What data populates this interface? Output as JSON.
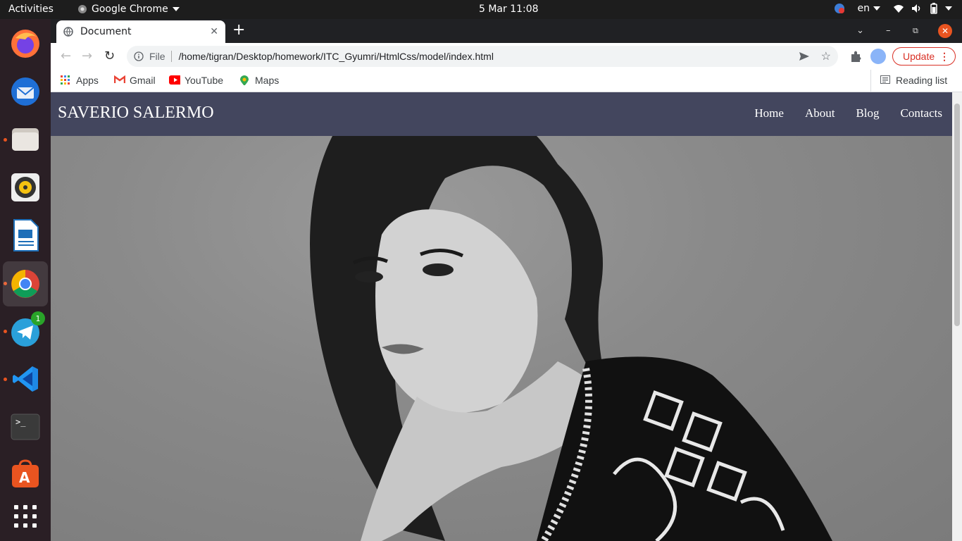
{
  "topbar": {
    "activities": "Activities",
    "app_name": "Google Chrome",
    "clock": "5 Mar  11:08",
    "language": "en"
  },
  "dock": {
    "items": [
      {
        "name": "firefox-icon"
      },
      {
        "name": "thunderbird-icon"
      },
      {
        "name": "files-icon"
      },
      {
        "name": "rhythmbox-icon"
      },
      {
        "name": "libreoffice-writer-icon"
      },
      {
        "name": "chrome-icon"
      },
      {
        "name": "telegram-icon",
        "badge": "1"
      },
      {
        "name": "vscode-icon"
      },
      {
        "name": "terminal-icon"
      },
      {
        "name": "software-center-icon"
      },
      {
        "name": "show-apps-icon"
      }
    ]
  },
  "browser": {
    "tab_title": "Document",
    "address_scheme": "File",
    "address_url": "/home/tigran/Desktop/homework/ITC_Gyumri/HtmlCss/model/index.html",
    "update_label": "Update",
    "bookmarks": [
      "Apps",
      "Gmail",
      "YouTube",
      "Maps"
    ],
    "reading_list": "Reading list"
  },
  "site": {
    "brand": "SAVERIO SALERMO",
    "nav": [
      "Home",
      "About",
      "Blog",
      "Contacts"
    ]
  },
  "colors": {
    "site_nav_bg": "#43465e",
    "accent": "#e95420",
    "update_red": "#d93025"
  }
}
